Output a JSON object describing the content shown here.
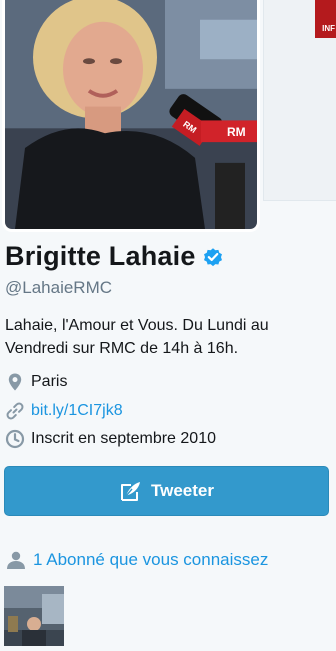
{
  "profile": {
    "name": "Brigitte Lahaie",
    "handle": "@LahaieRMC",
    "bio": "Lahaie, l'Amour et Vous. Du Lundi au Vendredi sur RMC de 14h à 16h.",
    "location": "Paris",
    "url": "bit.ly/1CI7jk8",
    "joined": "Inscrit en septembre 2010",
    "photo_logo_text": "RM",
    "side_thumb_text": "INF"
  },
  "actions": {
    "tweet_label": "Tweeter"
  },
  "followers": {
    "label": "1 Abonné que vous connaissez"
  },
  "icons": {
    "verified": "verified-badge-icon",
    "location": "location-pin-icon",
    "link": "link-icon",
    "joined": "clock-icon",
    "tweet": "compose-feather-icon",
    "followers": "person-icon"
  },
  "colors": {
    "link": "#1b95e0",
    "button": "#3399cc",
    "muted": "#657786",
    "verified": "#1da1f2"
  }
}
